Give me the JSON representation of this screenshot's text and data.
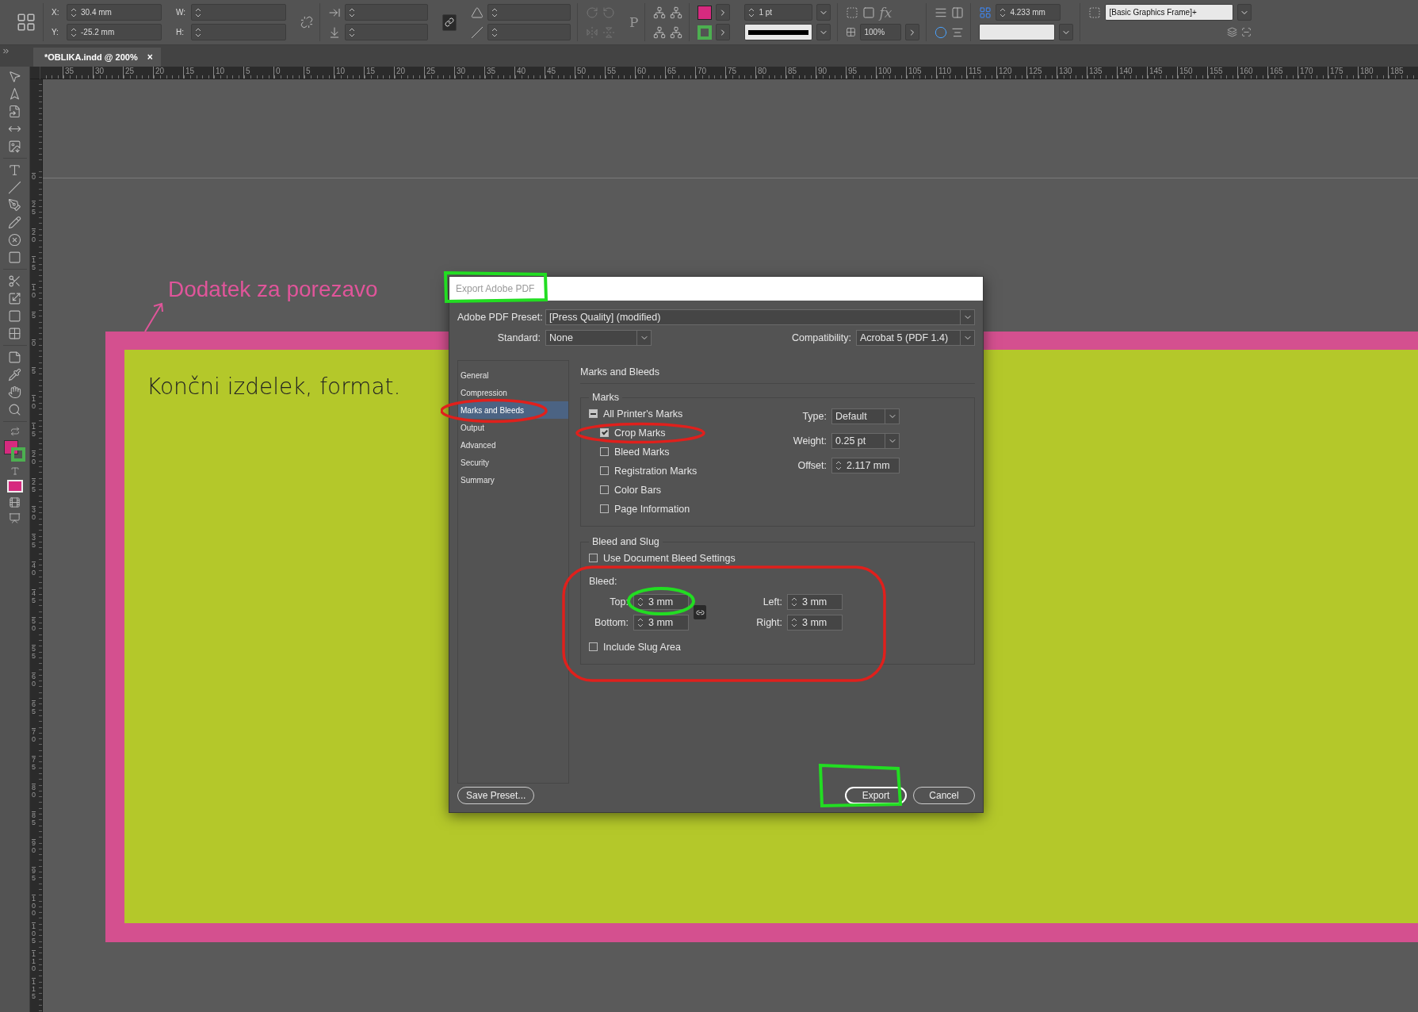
{
  "control_bar": {
    "x_label": "X:",
    "x_value": "30.4 mm",
    "y_label": "Y:",
    "y_value": "-25.2 mm",
    "w_label": "W:",
    "h_label": "H:",
    "frame_glyph": "P",
    "stroke_weight": "1 pt",
    "effects_glyph": "fx",
    "opacity": "100%",
    "spacing": "4.233 mm",
    "object_style": "[Basic Graphics Frame]+"
  },
  "document_tab": {
    "title": "*OBLIKA.indd @ 200%",
    "close": "×"
  },
  "ruler": {
    "horizontal": [
      "35",
      "30",
      "25",
      "20",
      "15",
      "10",
      "5",
      "0",
      "5",
      "10",
      "15",
      "20",
      "25",
      "30",
      "35",
      "40",
      "45",
      "50",
      "55",
      "60",
      "65",
      "70",
      "75",
      "80",
      "85",
      "90",
      "95",
      "100",
      "105",
      "110",
      "115",
      "120",
      "125",
      "130",
      "135",
      "140",
      "145",
      "150",
      "155",
      "160",
      "165",
      "170",
      "175",
      "180",
      "185"
    ],
    "vertical": [
      "0",
      "25",
      "20",
      "15",
      "10",
      "5",
      "0",
      "5",
      "10",
      "15",
      "20",
      "25",
      "30",
      "35",
      "40",
      "45",
      "50",
      "55",
      "60",
      "65",
      "70",
      "75",
      "80",
      "85",
      "90",
      "95",
      "100",
      "105",
      "110",
      "115"
    ]
  },
  "canvas": {
    "bleed_note": "Dodatek za porezavo",
    "page_text": "Končni izdelek, format."
  },
  "dialog": {
    "title": "Export Adobe PDF",
    "preset_label": "Adobe PDF Preset:",
    "preset": "[Press Quality] (modified)",
    "standard_label": "Standard:",
    "standard": "None",
    "compatibility_label": "Compatibility:",
    "compatibility": "Acrobat 5 (PDF 1.4)",
    "nav": [
      {
        "label": "General",
        "selected": false
      },
      {
        "label": "Compression",
        "selected": false
      },
      {
        "label": "Marks and Bleeds",
        "selected": true
      },
      {
        "label": "Output",
        "selected": false
      },
      {
        "label": "Advanced",
        "selected": false
      },
      {
        "label": "Security",
        "selected": false
      },
      {
        "label": "Summary",
        "selected": false
      }
    ],
    "section_title": "Marks and Bleeds",
    "marks": {
      "title": "Marks",
      "all": {
        "label": "All Printer's Marks",
        "indeterminate": true
      },
      "items": [
        {
          "label": "Crop Marks",
          "checked": true
        },
        {
          "label": "Bleed Marks",
          "checked": false
        },
        {
          "label": "Registration Marks",
          "checked": false
        },
        {
          "label": "Color Bars",
          "checked": false
        },
        {
          "label": "Page Information",
          "checked": false
        }
      ],
      "type_label": "Type:",
      "type": "Default",
      "weight_label": "Weight:",
      "weight": "0.25 pt",
      "offset_label": "Offset:",
      "offset": "2.117 mm"
    },
    "bleed": {
      "title": "Bleed and Slug",
      "use_document": {
        "label": "Use Document Bleed Settings",
        "checked": false
      },
      "bleed_label": "Bleed:",
      "fields": [
        {
          "label": "Top:",
          "value": "3 mm"
        },
        {
          "label": "Left:",
          "value": "3 mm"
        },
        {
          "label": "Bottom:",
          "value": "3 mm"
        },
        {
          "label": "Right:",
          "value": "3 mm"
        }
      ],
      "include_slug": {
        "label": "Include Slug Area",
        "checked": false
      }
    },
    "buttons": {
      "save_preset": "Save Preset...",
      "export": "Export",
      "cancel": "Cancel"
    }
  }
}
